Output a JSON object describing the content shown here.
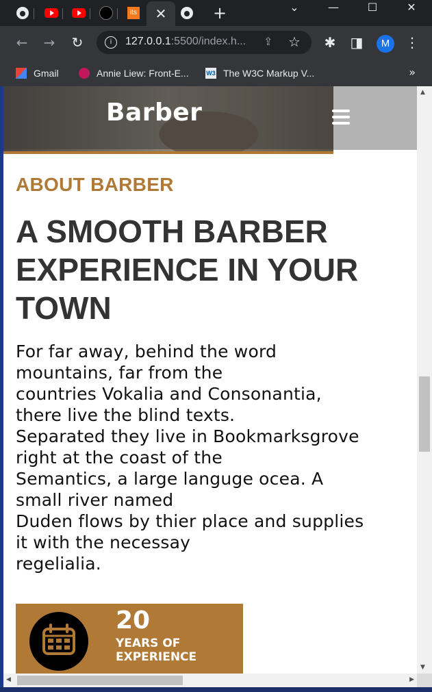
{
  "browser": {
    "tabs": [
      {
        "icon": "github-icon"
      },
      {
        "icon": "youtube-icon"
      },
      {
        "icon": "youtube-icon"
      },
      {
        "icon": "dark-circle-icon"
      },
      {
        "icon_text": "its"
      },
      {
        "close_label": "✕"
      },
      {
        "icon": "github-icon"
      }
    ],
    "new_tab_label": "+",
    "window_controls": {
      "dropdown": "⌄",
      "minimize": "—",
      "maximize": "☐",
      "close": "✕"
    },
    "nav": {
      "back": "←",
      "forward": "→",
      "reload": "↻"
    },
    "address": {
      "info": "i",
      "host": "127.0.0.1",
      "rest": ":5500/index.h..."
    },
    "extensions_icon": "✱",
    "profile_initial": "M",
    "menu_label": "⋮",
    "bookmarks": [
      {
        "label": "Gmail"
      },
      {
        "label": "Annie Liew: Front-E..."
      },
      {
        "label": "The W3C Markup V...",
        "icon_text": "W3"
      }
    ],
    "bookmarks_more": "»"
  },
  "page": {
    "brand": "Barber",
    "section_label": "ABOUT BARBER",
    "headline": "A SMOOTH BARBER EXPERIENCE IN YOUR TOWN",
    "paragraph_lines": [
      "For far away, behind the word",
      "mountains, far from the",
      "countries Vokalia and Consonantia,",
      "there live the blind texts.",
      "Separated they live in Bookmarksgrove",
      "right at the coast of the",
      "Semantics, a large languge ocea. A",
      "small river named",
      "Duden flows by thier place and supplies",
      "it with the necessay",
      "regelialia."
    ],
    "stat": {
      "number": "20",
      "line1": "YEARS OF",
      "line2": "EXPERIENCE"
    }
  },
  "colors": {
    "accent": "#b07a36",
    "heading": "#333333"
  }
}
